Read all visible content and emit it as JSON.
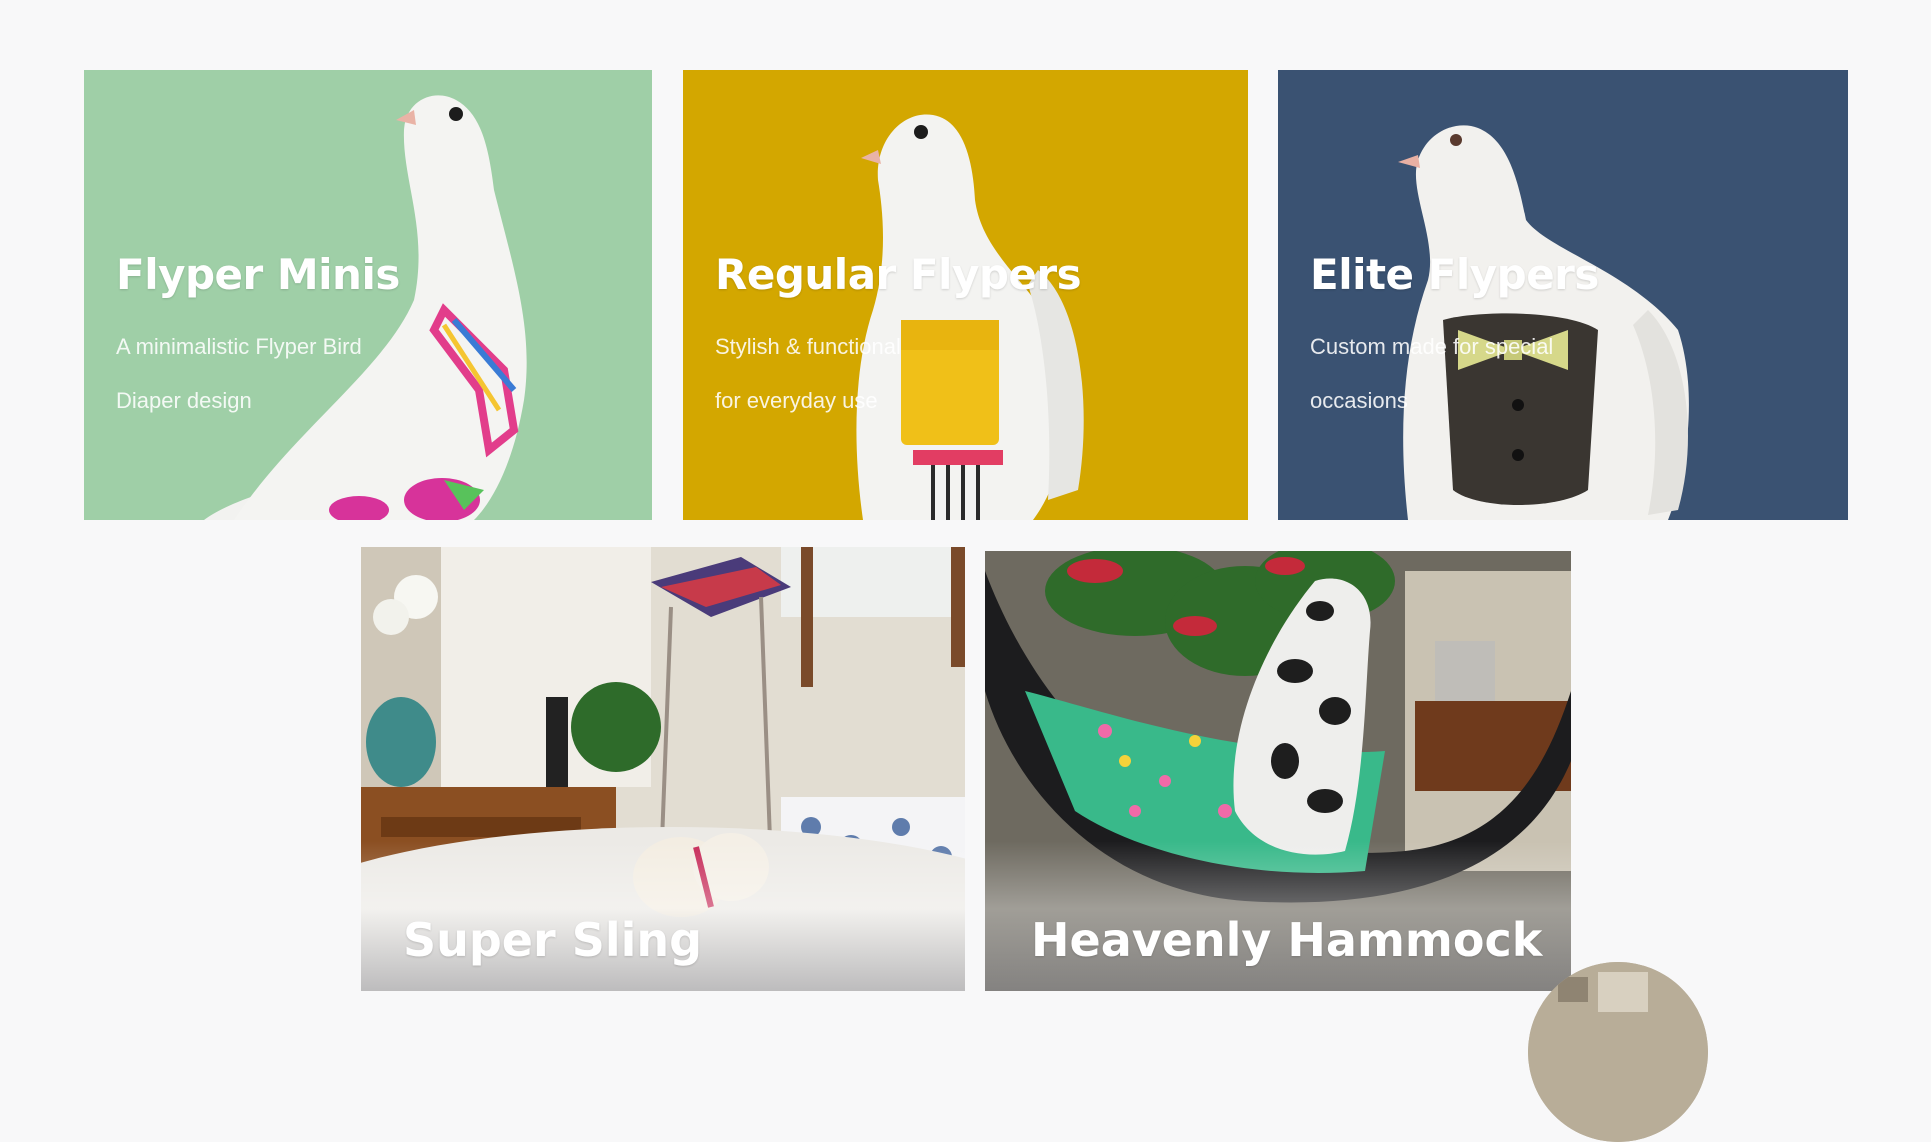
{
  "products": [
    {
      "id": "minis",
      "title": "Flyper Minis",
      "description_lines": [
        "A minimalistic Flyper Bird",
        "Diaper design"
      ],
      "background": "#9fcfa7"
    },
    {
      "id": "regular",
      "title": "Regular Flypers",
      "description_lines": [
        "Stylish & functional",
        "for everyday use"
      ],
      "background": "#d3a700"
    },
    {
      "id": "elite",
      "title": "Elite Flypers",
      "description_lines": [
        "Custom made for special",
        "occasions"
      ],
      "background": "#3a5272"
    }
  ],
  "accessories": [
    {
      "id": "sling",
      "title": "Super Sling"
    },
    {
      "id": "hammock",
      "title": "Heavenly Hammock"
    }
  ],
  "colors": {
    "page_background": "#f8f8f9",
    "text": "#ffffff"
  }
}
